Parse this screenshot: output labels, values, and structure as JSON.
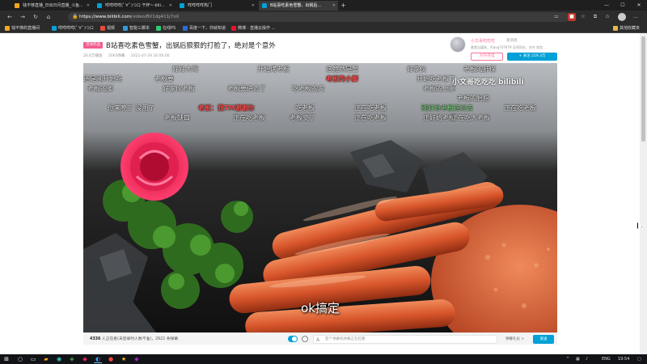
{
  "browser": {
    "tabs": [
      {
        "title": "钱不够直播_日出日月直播_斗鱼...",
        "active": false
      },
      {
        "title": "咩咩咩咩(ﾟ∀ﾟ)つロ 干杯~-bili...",
        "active": false
      },
      {
        "title": "咩咩咩咩热门",
        "active": false
      },
      {
        "title": "B站喜吃素色雪蟹，出锅后...",
        "active": true
      }
    ],
    "new_tab": "+",
    "window_controls": {
      "minimize": "—",
      "maximize": "☐",
      "close": "✕"
    },
    "url_host": "https://www.bilibili.com",
    "url_path": "/video/BV1dg411j7oX",
    "bookmarks": [
      {
        "label": "钱不够的直播间",
        "color": "#f5a623"
      },
      {
        "label": "咩咩咩咩(ﾟ∀ﾟ)つロ",
        "color": "#00a1d6"
      },
      {
        "label": "视频",
        "color": "#e74c3c"
      },
      {
        "label": "智能三脚本",
        "color": "#3498db"
      },
      {
        "label": "在线PS",
        "color": "#2ecc71"
      },
      {
        "label": "百度一下，你就知道",
        "color": "#2f6bd8"
      },
      {
        "label": "微博 - 直播云操作 ...",
        "color": "#e6162d"
      }
    ],
    "other_bookmarks": "其他收藏夹"
  },
  "video": {
    "badge": "活动作品",
    "title": "B站喜吃素色雪蟹，出锅后狠狠的打脸了，绝对是个意外",
    "views": "26.6万播放",
    "danmaku_count": "2063弹幕",
    "date": "2021-07-29 16:00:00"
  },
  "uploader": {
    "name": "小文哥吃吃吃",
    "message": "发消息",
    "desc": "美食自媒体，Xiaog707879 全网同名，合作 商务...",
    "charge_label": "为TA充电",
    "follow_label": "关注 219.3万",
    "follow_icon": "+"
  },
  "player": {
    "watermark": "小文哥吃吃吃 bilibili",
    "subtitle": "ok搞定",
    "danmaku": [
      {
        "text": "好好大啊",
        "color": "white"
      },
      {
        "text": "开始烤老板",
        "color": "white"
      },
      {
        "text": "这竟然是蟹",
        "color": "white"
      },
      {
        "text": "好家伙",
        "color": "white"
      },
      {
        "text": "老板的肺保",
        "color": "white"
      },
      {
        "text": "还是刚开始吃",
        "color": "white"
      },
      {
        "text": "老板要",
        "color": "white"
      },
      {
        "text": "老板的小脚",
        "color": "red"
      },
      {
        "text": "开始吃老板了",
        "color": "white"
      },
      {
        "text": "老板的脚",
        "color": "white"
      },
      {
        "text": "好家伙老板",
        "color": "white"
      },
      {
        "text": "老板要进去了",
        "color": "white"
      },
      {
        "text": "吃老板的内",
        "color": "white"
      },
      {
        "text": "老板的上腿",
        "color": "white"
      },
      {
        "text": "你来晚了 没用了",
        "color": "white"
      },
      {
        "text": "老板：我TM谢谢你",
        "color": "red"
      },
      {
        "text": "吃老板",
        "color": "white"
      },
      {
        "text": "正在吃老板",
        "color": "white"
      },
      {
        "text": "刚好给老板送过去",
        "color": "green"
      },
      {
        "text": "正在吃老板",
        "color": "white"
      },
      {
        "text": "老板缺口",
        "color": "white"
      },
      {
        "text": "正在吃老板",
        "color": "white"
      },
      {
        "text": "老板变了",
        "color": "white"
      },
      {
        "text": "正在吃老板",
        "color": "white"
      },
      {
        "text": "正好给老板",
        "color": "white"
      },
      {
        "text": "正在吃大老板",
        "color": "white"
      },
      {
        "text": "老板的胎脂",
        "color": "white"
      }
    ]
  },
  "sendbar": {
    "viewers_count": "4336",
    "viewers_text": "人正在看(未登录时人数不准)，2922 条弹幕",
    "input_placeholder": "登个弹幕机弹幕正在赶路",
    "etiquette": "弹幕礼仪 >",
    "send_label": "发送"
  },
  "taskbar": {
    "language": "ENG",
    "time": "19:54"
  },
  "colors": {
    "bili_blue": "#00a1d6",
    "bili_pink": "#fb7299"
  }
}
